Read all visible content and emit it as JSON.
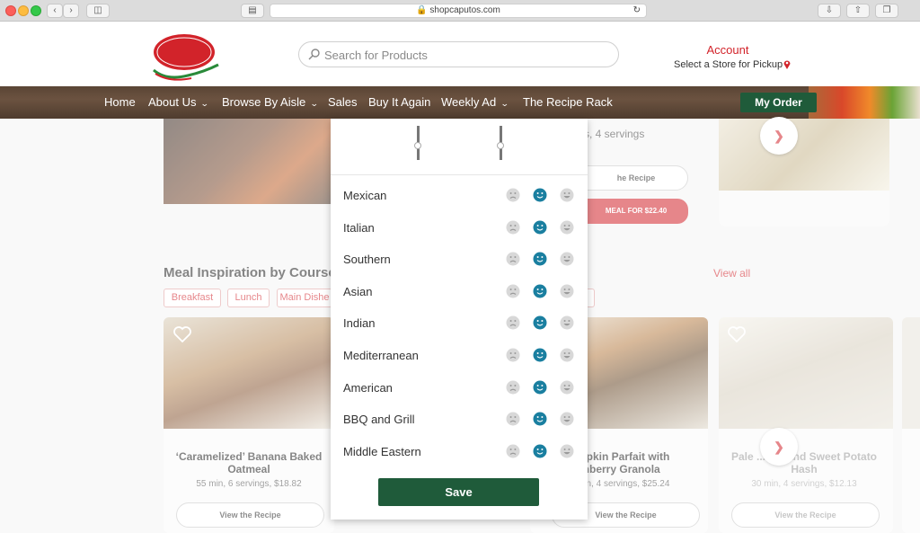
{
  "browser": {
    "url": "shopcaputos.com"
  },
  "header": {
    "logo_text": "Caputo's",
    "logo_script": "Angelo",
    "logo_since": "Since 1958",
    "logo_tagline": "Fresh Markets",
    "search_placeholder": "Search for Products",
    "account_label": "Account",
    "store_label": "Select a Store for Pickup"
  },
  "nav": {
    "items": [
      "Home",
      "About Us",
      "Browse By Aisle",
      "Sales",
      "Buy It Again",
      "Weekly Ad",
      "The Recipe Rack"
    ],
    "my_order": "My Order"
  },
  "background": {
    "servings_text": "s, 4 servings",
    "view_recipe_partial": "he Recipe",
    "add_meal_partial": "MEAL FOR $22.40",
    "section_title": "Meal Inspiration by Course",
    "view_all": "View all",
    "pills": [
      "Breakfast",
      "Lunch",
      "Main Dishe"
    ],
    "cards": [
      {
        "title": "‘Caramelized’ Banana Baked Oatmeal",
        "meta": "55 min, 6 servings, $18.82",
        "button": "View the Recipe"
      },
      {
        "title": "mpkin Parfait with anberry Granola",
        "meta": "min, 4 servings, $25.24",
        "button": "View the Recipe"
      },
      {
        "title": "Pale ...age and Sweet Potato Hash",
        "meta": "30 min, 4 servings, $12.13",
        "button": "View the Recipe"
      }
    ]
  },
  "modal": {
    "cuisines": [
      "Mexican",
      "Italian",
      "Southern",
      "Asian",
      "Indian",
      "Mediterranean",
      "American",
      "BBQ and Grill",
      "Middle Eastern"
    ],
    "selected_rating": "neutral",
    "save_label": "Save",
    "accent_color": "#1a7fa0"
  }
}
